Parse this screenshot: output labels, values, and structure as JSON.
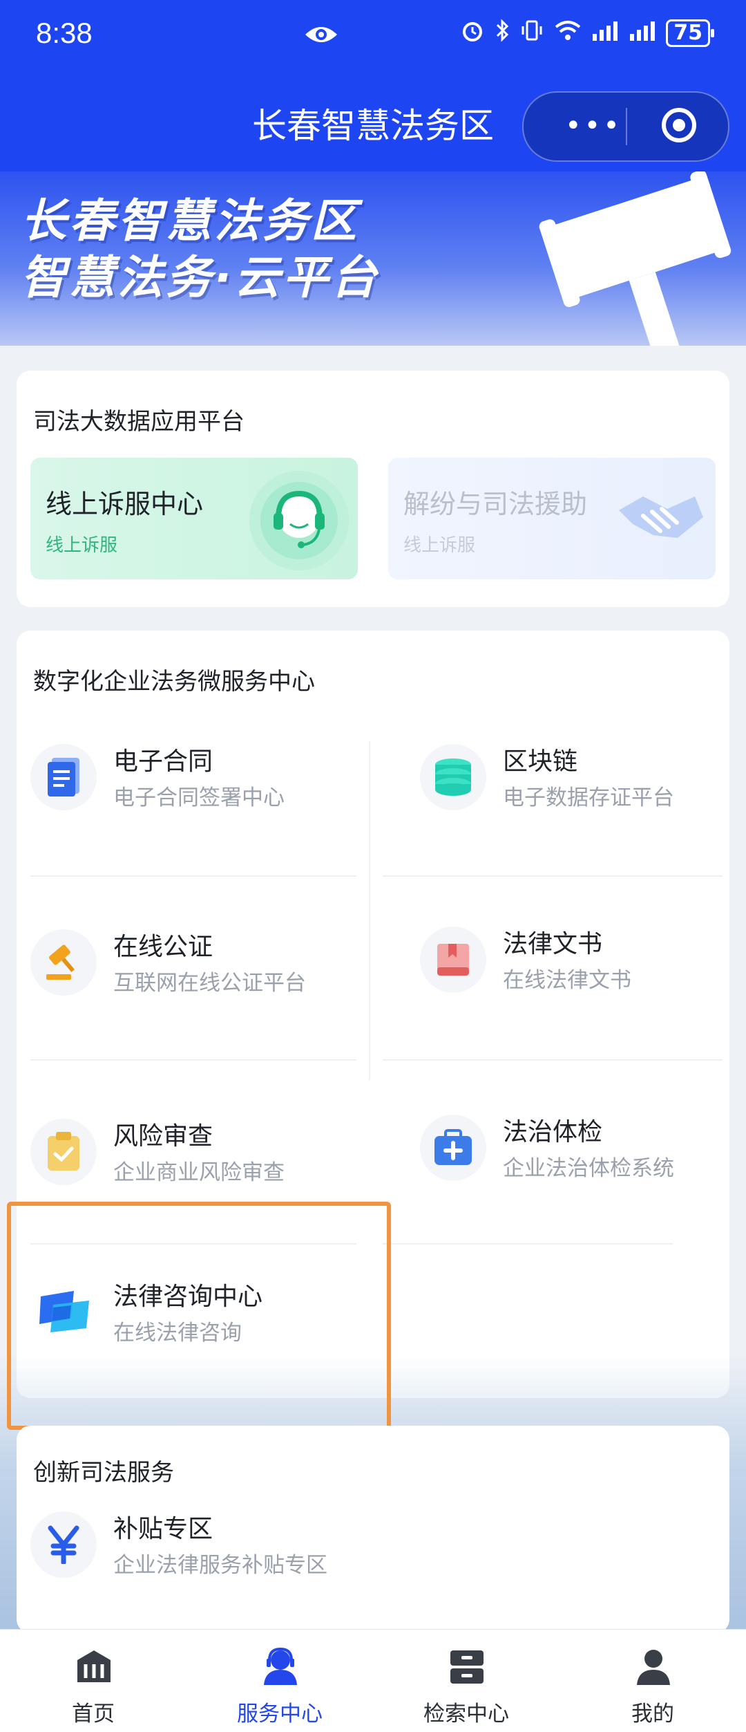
{
  "status_bar": {
    "time": "8:38",
    "battery": "75"
  },
  "nav": {
    "title": "长春智慧法务区",
    "more_label": "•••"
  },
  "banner": {
    "line1": "长春智慧法务区",
    "line2": "智慧法务·云平台"
  },
  "judicial_platform": {
    "title": "司法大数据应用平台",
    "tiles": [
      {
        "title": "线上诉服中心",
        "subtitle": "线上诉服",
        "icon": "customer-service-icon"
      },
      {
        "title": "解纷与司法援助",
        "subtitle": "线上诉服",
        "icon": "handshake-icon"
      }
    ]
  },
  "enterprise_center": {
    "title": "数字化企业法务微服务中心",
    "services": [
      {
        "name": "电子合同",
        "desc": "电子合同签署中心",
        "icon": "document-icon"
      },
      {
        "name": "区块链",
        "desc": "电子数据存证平台",
        "icon": "database-icon"
      },
      {
        "name": "在线公证",
        "desc": "互联网在线公证平台",
        "icon": "gavel-icon"
      },
      {
        "name": "法律文书",
        "desc": "在线法律文书",
        "icon": "book-icon"
      },
      {
        "name": "风险审查",
        "desc": "企业商业风险审查",
        "icon": "clipboard-check-icon"
      },
      {
        "name": "法治体检",
        "desc": "企业法治体检系统",
        "icon": "medical-kit-icon"
      },
      {
        "name": "法律咨询中心",
        "desc": "在线法律咨询",
        "icon": "chat-bubbles-icon"
      }
    ]
  },
  "innovation": {
    "title": "创新司法服务",
    "services": [
      {
        "name": "补贴专区",
        "desc": "企业法律服务补贴专区",
        "icon": "yen-icon"
      }
    ]
  },
  "tabbar": {
    "tabs": [
      {
        "label": "首页",
        "icon": "home-pillars-icon",
        "active": false
      },
      {
        "label": "服务中心",
        "icon": "person-service-icon",
        "active": true
      },
      {
        "label": "检索中心",
        "icon": "cabinet-icon",
        "active": false
      },
      {
        "label": "我的",
        "icon": "user-icon",
        "active": false
      }
    ]
  },
  "colors": {
    "primary": "#1d45f2",
    "highlight_box": "#f0943f",
    "tile_green_text": "#2fb67d"
  }
}
